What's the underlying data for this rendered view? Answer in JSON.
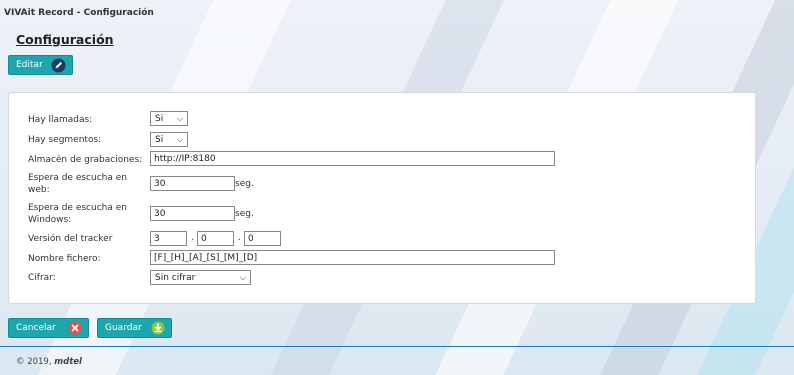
{
  "app": {
    "title": "VIVAit Record - Configuración"
  },
  "page": {
    "title": "Configuración"
  },
  "buttons": {
    "edit": "Editar",
    "cancel": "Cancelar",
    "save": "Guardar"
  },
  "form": {
    "hay_llamadas": {
      "label": "Hay llamadas:",
      "value": "Si"
    },
    "hay_segmentos": {
      "label": "Hay segmentos:",
      "value": "Si"
    },
    "almacen": {
      "label": "Almacén de grabaciones:",
      "value": "http://IP:8180"
    },
    "espera_web": {
      "label_line1": "Espera de escucha en",
      "label_line2": "web:",
      "value": "30",
      "unit": "seg."
    },
    "espera_windows": {
      "label_line1": "Espera de escucha en",
      "label_line2": "Windows:",
      "value": "30",
      "unit": "seg."
    },
    "version_tracker": {
      "label": "Versión del tracker",
      "major": "3",
      "minor": "0",
      "patch": "0",
      "separator": "."
    },
    "nombre_fichero": {
      "label": "Nombre fichero:",
      "value": "[F]_[H]_[A]_[S]_[M]_[D]"
    },
    "cifrar": {
      "label": "Cifrar:",
      "value": "Sin cifrar"
    }
  },
  "footer": {
    "copyright": "© 2019,",
    "brand": "mdtel"
  },
  "icons": {
    "edit": "pencil-icon",
    "cancel": "close-circle-icon",
    "save": "save-arrow-icon",
    "select": "chevron-down-icon"
  },
  "colors": {
    "accent": "#1ea6ae",
    "footer_line": "#1a7fb0",
    "cancel_icon": "#e0524f",
    "save_icon": "#8cc63f"
  }
}
